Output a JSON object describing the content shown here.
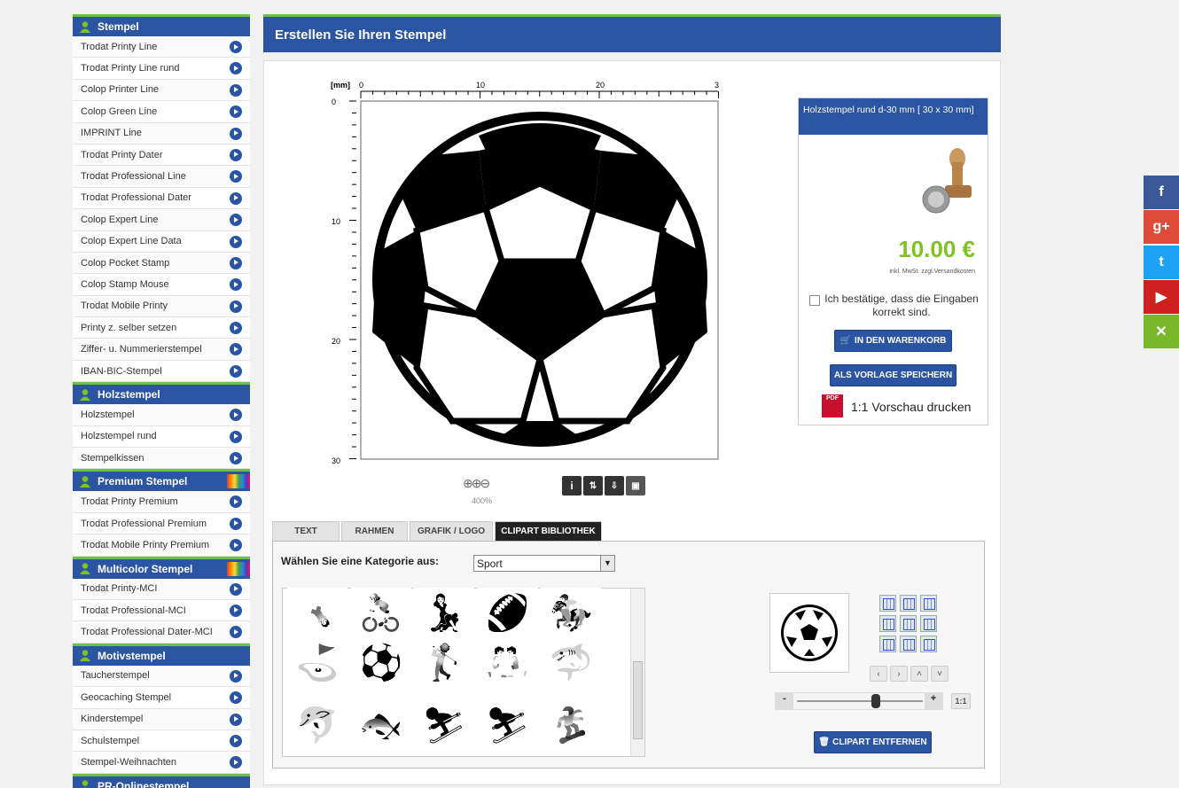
{
  "sidebar": {
    "sections": [
      {
        "title": "Stempel",
        "rainbow": false,
        "items": [
          "Trodat Printy Line",
          "Trodat Printy Line rund",
          "Colop Printer Line",
          "Colop Green Line",
          "IMPRINT Line",
          "Trodat Printy Dater",
          "Trodat Professional Line",
          "Trodat Professional Dater",
          "Colop Expert Line",
          "Colop Expert Line Data",
          "Colop Pocket Stamp",
          "Colop Stamp Mouse",
          "Trodat Mobile Printy",
          "Printy z. selber setzen",
          "Ziffer- u. Nummerierstempel",
          "IBAN-BIC-Stempel"
        ]
      },
      {
        "title": "Holzstempel",
        "rainbow": false,
        "items": [
          "Holzstempel",
          "Holzstempel rund",
          "Stempelkissen"
        ]
      },
      {
        "title": "Premium Stempel",
        "rainbow": true,
        "items": [
          "Trodat Printy Premium",
          "Trodat Professional Premium",
          "Trodat Mobile Printy Premium"
        ]
      },
      {
        "title": "Multicolor Stempel",
        "rainbow": true,
        "items": [
          "Trodat Printy-MCI",
          "Trodat Professional-MCI",
          "Trodat Professional Dater-MCI"
        ]
      },
      {
        "title": "Motivstempel",
        "rainbow": false,
        "items": [
          "Taucherstempel",
          "Geocaching Stempel",
          "Kinderstempel",
          "Schulstempel",
          "Stempel-Weihnachten"
        ]
      },
      {
        "title": "PR-Onlinestempel",
        "rainbow": false,
        "items": []
      }
    ]
  },
  "main": {
    "title": "Erstellen Sie Ihren Stempel",
    "ruler": {
      "unit": "[mm]",
      "x_ticks": [
        "0",
        "10",
        "20",
        "3"
      ],
      "y_ticks": [
        "0",
        "10",
        "20",
        "30"
      ]
    },
    "zoom": "400%",
    "tabs": [
      "TEXT",
      "RAHMEN",
      "GRAFIK / LOGO",
      "CLIPART BIBLIOTHEK"
    ],
    "active_tab": "CLIPART BIBLIOTHEK",
    "category_label": "Wählen Sie eine Kategorie aus:",
    "category_value": "Sport",
    "remove_clipart": "CLIPART ENTFERNEN",
    "scale_minus": "-",
    "scale_plus": "+",
    "scale_reset": "1:1"
  },
  "product": {
    "name": "Holzstempel rund d-30 mm [ 30 x 30 mm]",
    "price": "10.00 €",
    "price_note": "inkl. MwSt. zzgl.Versandkosten",
    "confirm_text": "Ich bestätige, dass die Eingaben korrekt sind.",
    "cart_button": "IN DEN WARENKORB",
    "save_button": "ALS VORLAGE SPEICHERN",
    "preview_text": "1:1 Vorschau drucken"
  },
  "social": [
    {
      "name": "facebook",
      "glyph": "f",
      "color": "#3b5998"
    },
    {
      "name": "google-plus",
      "glyph": "g+",
      "color": "#dd4b39"
    },
    {
      "name": "twitter",
      "glyph": "t",
      "color": "#1da1f2"
    },
    {
      "name": "youtube",
      "glyph": "▶",
      "color": "#cd201f"
    },
    {
      "name": "xing",
      "glyph": "✕",
      "color": "#7ab82b"
    }
  ],
  "colors": {
    "blue": "#2b55a3",
    "green": "#6cc045",
    "price": "#7fc41e"
  }
}
